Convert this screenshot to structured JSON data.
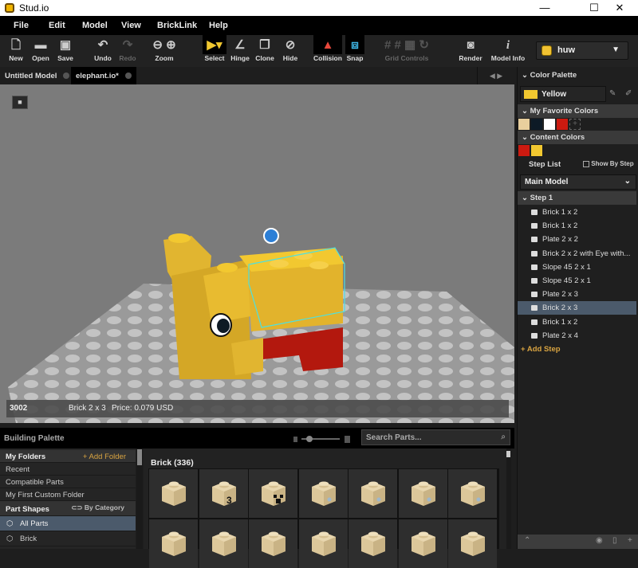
{
  "window": {
    "title": "Stud.io",
    "minimize": "—",
    "maximize": "☐",
    "close": "✕"
  },
  "menu": [
    "File",
    "Edit",
    "Model",
    "View",
    "BrickLink",
    "Help"
  ],
  "toolbar": {
    "new": "New",
    "open": "Open",
    "save": "Save",
    "undo": "Undo",
    "redo": "Redo",
    "zoom": "Zoom",
    "select": "Select",
    "hinge": "Hinge",
    "clone": "Clone",
    "hide": "Hide",
    "collision": "Collision",
    "snap": "Snap",
    "grid_controls": "Grid Controls",
    "render": "Render",
    "model_info": "Model Info"
  },
  "user": {
    "name": "huw"
  },
  "tabs": [
    {
      "label": "Untitled Model"
    },
    {
      "label": "elephant.io*"
    }
  ],
  "viewport": {
    "status": {
      "part_id": "3002",
      "part_name": "Brick 2 x 3",
      "price": "Price: 0.079 USD"
    }
  },
  "building_palette": {
    "title": "Building Palette",
    "search_placeholder": "Search Parts...",
    "folders_header": "My Folders",
    "add_folder": "+ Add Folder",
    "items": [
      "Recent",
      "Compatible Parts",
      "My First Custom Folder"
    ],
    "part_shapes_header": "Part Shapes",
    "by_category": "By Category",
    "categories": [
      "All Parts",
      "Brick"
    ],
    "grid_title": "Brick (336)",
    "parts": [
      "plain",
      "printed-3",
      "creeper-face",
      "dot-light",
      "dot-light",
      "dot-light",
      "dot-light"
    ]
  },
  "right_panel": {
    "color_palette": "Color Palette",
    "selected_color": {
      "name": "Yellow",
      "hex": "#f2c830"
    },
    "favorites_header": "My Favorite Colors",
    "favorites": [
      "#e8cf9d",
      "#0d1a26",
      "#ffffff",
      "#cc1a10"
    ],
    "content_header": "Content Colors",
    "content": [
      "#cc1a10",
      "#f2c830"
    ],
    "step_list": "Step List",
    "show_by_step": "Show By Step",
    "model_select": "Main Model",
    "step_header": "Step 1",
    "steps": [
      "Brick 1 x 2",
      "Brick 1 x 2",
      "Plate 2 x 2",
      "Brick 2 x 2 with Eye with...",
      "Slope 45 2 x 1",
      "Slope 45 2 x 1",
      "Plate 2 x 3",
      "Brick 2 x 3",
      "Brick 1 x 2",
      "Plate 2 x 4"
    ],
    "selected_step_index": 7,
    "add_step": "+ Add Step"
  }
}
